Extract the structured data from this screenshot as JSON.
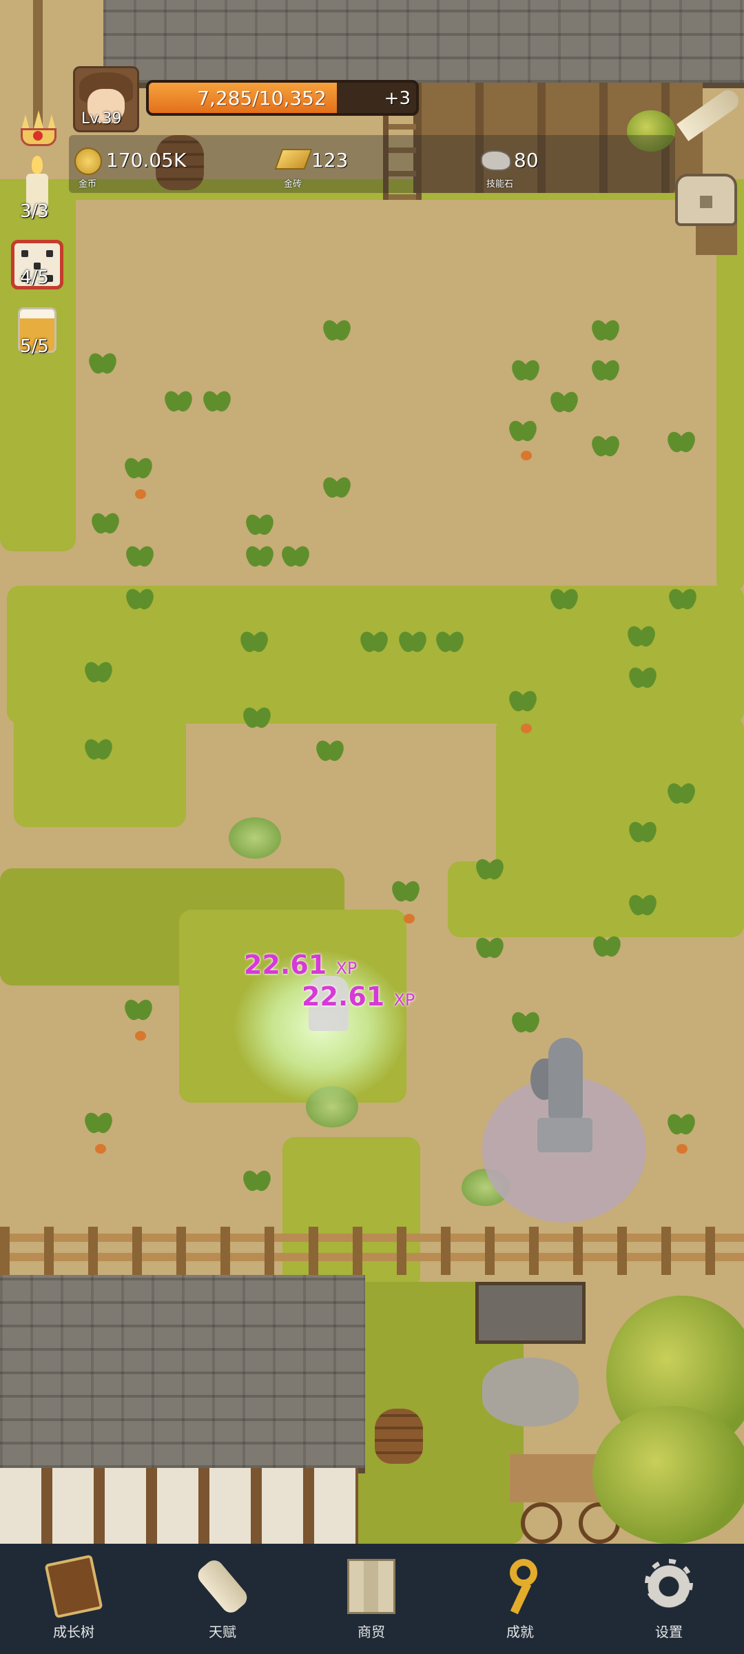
{
  "player": {
    "level": "Lv.39",
    "xp_text": "7,285/10,352",
    "xp_progress": 0.704,
    "bonus": "+3"
  },
  "resources": [
    {
      "id": "gold_coin",
      "value": "170.05K",
      "caption": "金币",
      "icon": "coin-icon"
    },
    {
      "id": "gold_brick",
      "value": "123",
      "caption": "金砖",
      "icon": "gold-bar-icon"
    },
    {
      "id": "skill_stone",
      "value": "80",
      "caption": "技能石",
      "icon": "stone-icon"
    }
  ],
  "side_items": [
    {
      "icon": "crown-icon",
      "count": ""
    },
    {
      "icon": "candle-icon",
      "count": "3/3"
    },
    {
      "icon": "dice-icon",
      "count": "4/5"
    },
    {
      "icon": "beer-mug-icon",
      "count": "5/5"
    }
  ],
  "floating": [
    {
      "value": "22.61",
      "unit": "XP"
    },
    {
      "value": "22.61",
      "unit": "XP"
    }
  ],
  "nav": [
    {
      "label": "成长树",
      "icon": "book-icon"
    },
    {
      "label": "天赋",
      "icon": "scroll-icon"
    },
    {
      "label": "商贸",
      "icon": "map-icon"
    },
    {
      "label": "成就",
      "icon": "key-icon"
    },
    {
      "label": "设置",
      "icon": "gear-icon"
    }
  ],
  "colors": {
    "nav_bg": "#1f2a36",
    "xp_fill": "#e3701c",
    "xp_popup": "#d63ad6",
    "grass": "#a8b43a",
    "dirt": "#c7ad78"
  }
}
